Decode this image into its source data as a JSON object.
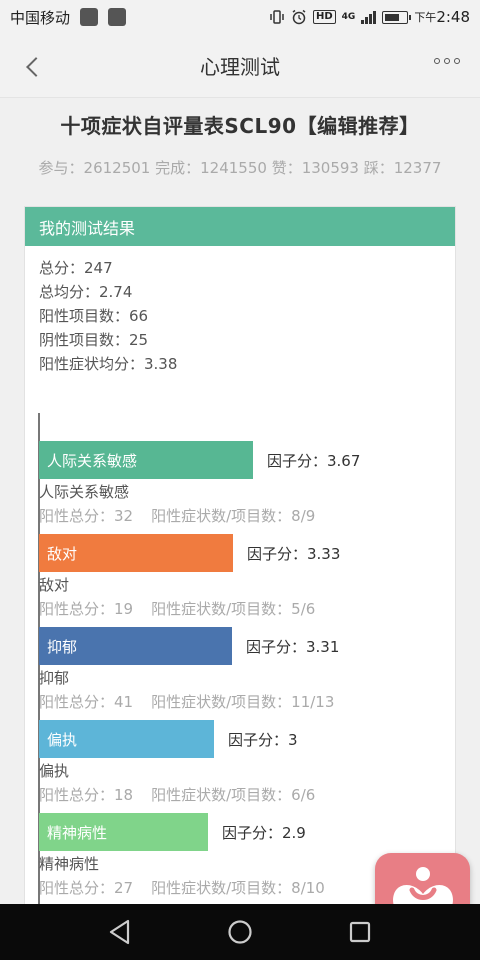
{
  "status": {
    "carrier": "中国移动",
    "signal_type": "4G",
    "hd": "HD",
    "ampm": "下午",
    "time": "2:48"
  },
  "header": {
    "title": "心理测试"
  },
  "test": {
    "title": "十项症状自评量表SCL90【编辑推荐】",
    "stats": "参与：2612501 完成：1241550 赞：130593 踩：12377"
  },
  "result": {
    "heading": "我的测试结果",
    "summary": [
      "总分：247",
      "总均分：2.74",
      "阳性项目数：66",
      "阴性项目数：25",
      "阳性症状均分：3.38"
    ]
  },
  "chart_data": {
    "type": "bar",
    "orientation": "horizontal",
    "value_label_prefix": "因子分：",
    "categories": [
      "人际关系敏感",
      "敌对",
      "抑郁",
      "偏执",
      "精神病性"
    ],
    "values": [
      3.67,
      3.33,
      3.31,
      3,
      2.9
    ],
    "value_labels": [
      "3.67",
      "3.33",
      "3.31",
      "3",
      "2.9"
    ],
    "colors": [
      "#57b793",
      "#f07b3f",
      "#4a74ae",
      "#5db5d8",
      "#80d48a"
    ],
    "details": [
      {
        "name": "人际关系敏感",
        "positive_total": "阳性总分：32",
        "ratio": "阳性症状数/项目数：8/9"
      },
      {
        "name": "敌对",
        "positive_total": "阳性总分：19",
        "ratio": "阳性症状数/项目数：5/6"
      },
      {
        "name": "抑郁",
        "positive_total": "阳性总分：41",
        "ratio": "阳性症状数/项目数：11/13"
      },
      {
        "name": "偏执",
        "positive_total": "阳性总分：18",
        "ratio": "阳性症状数/项目数：6/6"
      },
      {
        "name": "精神病性",
        "positive_total": "阳性总分：27",
        "ratio": "阳性症状数/项目数：8/10"
      }
    ]
  },
  "fab": {
    "icon": "heart-person-icon",
    "color": "#e87e85"
  },
  "nav": {
    "icons": [
      "back-triangle-icon",
      "home-circle-icon",
      "recents-square-icon"
    ]
  }
}
